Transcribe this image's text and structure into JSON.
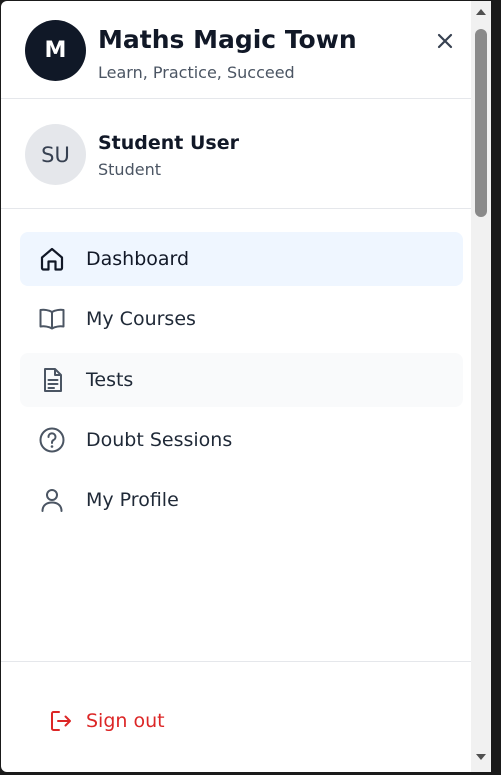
{
  "header": {
    "logo_letter": "M",
    "title": "Maths Magic Town",
    "subtitle": "Learn, Practice, Succeed"
  },
  "user": {
    "initials": "SU",
    "name": "Student User",
    "role": "Student"
  },
  "nav": {
    "items": [
      {
        "label": "Dashboard",
        "icon": "home-icon",
        "state": "active"
      },
      {
        "label": "My Courses",
        "icon": "book-open-icon",
        "state": "default"
      },
      {
        "label": "Tests",
        "icon": "document-icon",
        "state": "hover"
      },
      {
        "label": "Doubt Sessions",
        "icon": "question-circle-icon",
        "state": "default"
      },
      {
        "label": "My Profile",
        "icon": "user-icon",
        "state": "default"
      }
    ]
  },
  "footer": {
    "signout_label": "Sign out",
    "signout_icon": "logout-icon"
  },
  "colors": {
    "brand_dark": "#101827",
    "active_bg": "#eff6ff",
    "hover_bg": "#f9fafb",
    "danger": "#dc2626"
  }
}
